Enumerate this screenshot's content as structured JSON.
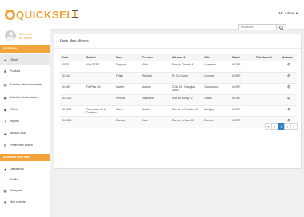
{
  "brand": {
    "name": "QUICKSELL",
    "color": "#f2a33a"
  },
  "topbar": {
    "user_menu": "Mr. Admin ▾"
  },
  "sidebar": {
    "profile": {
      "name": "Entreprise",
      "role": "Mr. Admin"
    },
    "sections": [
      {
        "title": "GESTION"
      },
      {
        "title": "ADMINISTRATION"
      }
    ],
    "gestion_items": [
      {
        "label": "Clients",
        "icon": "users-icon",
        "active": true
      },
      {
        "label": "Produits",
        "icon": "box-icon",
        "active": false
      },
      {
        "label": "Bulletins des commandes",
        "icon": "clipboard-icon",
        "active": false
      },
      {
        "label": "Bulletins des livraisons",
        "icon": "truck-icon",
        "active": false
      },
      {
        "label": "Offres",
        "icon": "tag-icon",
        "active": false
      },
      {
        "label": "Imports",
        "icon": "import-icon",
        "active": false
      },
      {
        "label": "Widen Cloud",
        "icon": "cloud-icon",
        "active": false
      },
      {
        "label": "Préférence Widen",
        "icon": "settings-icon",
        "active": false
      }
    ],
    "admin_items": [
      {
        "label": "Utilisateurs",
        "icon": "user-icon"
      },
      {
        "label": "Profils",
        "icon": "id-card-icon"
      },
      {
        "label": "Entreprise",
        "icon": "building-icon"
      },
      {
        "label": "Mon compte",
        "icon": "account-icon"
      }
    ]
  },
  "search": {
    "placeholder": "Recherche...",
    "button_icon": "search-icon"
  },
  "main": {
    "title": "Liste des clients",
    "columns": [
      "Code",
      "Société",
      "Nom",
      "Prénom",
      "Adresse 1",
      "Ville",
      "Statut",
      "Téléphone 1",
      "Actions"
    ],
    "rows": [
      [
        "00002",
        "Alku TEST",
        "Support",
        "Alku",
        "Rue du Chemin 4",
        "Lausanne",
        "ICONF",
        "",
        "👁"
      ],
      [
        "00-D42",
        "",
        "Fellay",
        "Richard",
        "Rt. Du Guem",
        "Oronina",
        "ICONF",
        "",
        "👁"
      ],
      [
        "00-H89",
        "FilePlus SA",
        "Martch",
        "Aurelia",
        "ZOA. Ch. Grangias Denis",
        "Courbedaux",
        "ICONF",
        "",
        "👁"
      ],
      [
        "00-1010",
        "",
        "Pernod",
        "Valentine",
        "Rue du Bourg 22",
        "Gravis",
        "ICONF",
        "",
        "👁"
      ],
      [
        "00-0000",
        "Pharmacie de la Fontaine",
        "Caron",
        "André",
        "Rue de la Fontaine 16",
        "Martigny",
        "ICONF",
        "",
        "👁"
      ],
      [
        "00-0001",
        "",
        "Conrad",
        "Julie",
        "Rue de la Gare 37",
        "Genève",
        "ICONF",
        "",
        "👁"
      ]
    ],
    "pagination": {
      "prev": "«",
      "previous": "‹",
      "current": "1",
      "next": "›",
      "last": "»"
    }
  }
}
